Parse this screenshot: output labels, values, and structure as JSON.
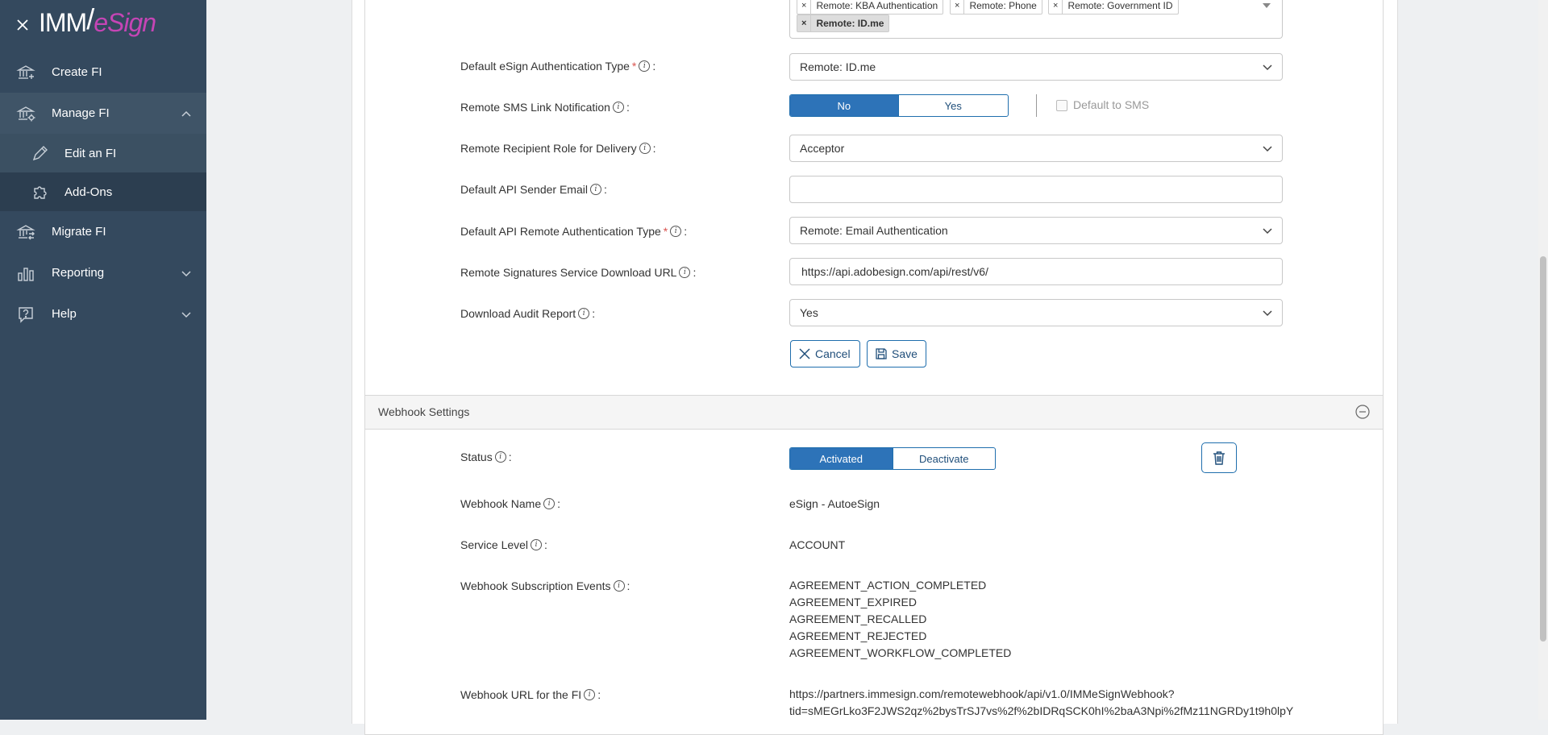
{
  "sidebar": {
    "logo_left": "IMM",
    "logo_right": "eSign",
    "items": [
      {
        "label": "Create FI"
      },
      {
        "label": "Manage FI"
      },
      {
        "label": "Edit an FI"
      },
      {
        "label": "Add-Ons"
      },
      {
        "label": "Migrate FI"
      },
      {
        "label": "Reporting"
      },
      {
        "label": "Help"
      }
    ]
  },
  "auth_types": {
    "chips": [
      {
        "label": "Remote: KBA Authentication"
      },
      {
        "label": "Remote: Phone"
      },
      {
        "label": "Remote: Government ID"
      },
      {
        "label": "Remote: ID.me"
      }
    ]
  },
  "form": {
    "default_auth_label": "Default eSign Authentication Type",
    "default_auth_value": "Remote: ID.me",
    "sms_label": "Remote SMS Link Notification",
    "sms_no": "No",
    "sms_yes": "Yes",
    "sms_selected": "No",
    "default_to_sms": "Default to SMS",
    "recipient_role_label": "Remote Recipient Role for Delivery",
    "recipient_role_value": "Acceptor",
    "api_sender_email_label": "Default API Sender Email",
    "api_sender_email_value": "",
    "api_auth_label": "Default API Remote Authentication Type",
    "api_auth_value": "Remote: Email Authentication",
    "download_url_label": "Remote Signatures Service Download URL",
    "download_url_value": "https://api.adobesign.com/api/rest/v6/",
    "audit_report_label": "Download Audit Report",
    "audit_report_value": "Yes",
    "cancel": "Cancel",
    "save": "Save",
    "colon": ":"
  },
  "webhook": {
    "section_title": "Webhook Settings",
    "status_label": "Status",
    "activated": "Activated",
    "deactivate": "Deactivate",
    "name_label": "Webhook Name",
    "name_value": "eSign - AutoeSign",
    "service_level_label": "Service Level",
    "service_level_value": "ACCOUNT",
    "events_label": "Webhook Subscription Events",
    "events": [
      "AGREEMENT_ACTION_COMPLETED",
      "AGREEMENT_EXPIRED",
      "AGREEMENT_RECALLED",
      "AGREEMENT_REJECTED",
      "AGREEMENT_WORKFLOW_COMPLETED"
    ],
    "url_label": "Webhook URL for the FI",
    "url_line1": "https://partners.immesign.com/remotewebhook/api/v1.0/IMMeSignWebhook?",
    "url_line2": "tid=sMEGrLko3F2JWS2qz%2bysTrSJ7vs%2f%2bIDRqSCK0hI%2baA3Npi%2fMz11NGRDy1t9h0lpY"
  },
  "colors": {
    "sidebar_bg": "#34495e",
    "accent_blue": "#2d73b8",
    "logo_magenta": "#c545b5",
    "required_red": "#d9534f"
  }
}
